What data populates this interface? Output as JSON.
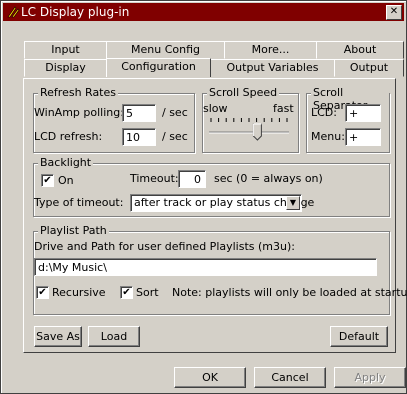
{
  "window": {
    "title": "LC Display plug-in",
    "close_glyph": "✕"
  },
  "tabs_row1": [
    "Input",
    "Menu Config",
    "More...",
    "About"
  ],
  "tabs_row2": [
    "Display",
    "Configuration",
    "Output Variables",
    "Output"
  ],
  "refresh": {
    "label": "Refresh Rates",
    "winamp_label": "WinAmp polling:",
    "winamp_value": "5",
    "winamp_unit": "/ sec",
    "lcd_label": "LCD refresh:",
    "lcd_value": "10",
    "lcd_unit": "/ sec"
  },
  "scroll_speed": {
    "label": "Scroll Speed",
    "slow": "slow",
    "fast": "fast",
    "level": 0.6
  },
  "scroll_sep": {
    "label": "Scroll Separator",
    "lcd_label": "LCD:",
    "lcd_value": "+",
    "menu_label": "Menu:",
    "menu_value": "+"
  },
  "backlight": {
    "label": "Backlight",
    "on_label": "On",
    "on_checked": "✔",
    "timeout_label": "Timeout:",
    "timeout_value": "0",
    "timeout_unit": "sec (0 = always on)",
    "type_label": "Type of timeout:",
    "type_value": "after track or play status change"
  },
  "playlist": {
    "label": "Playlist Path",
    "desc": "Drive and Path for user defined Playlists (m3u):",
    "path_value": "d:\\My Music\\",
    "recursive_label": "Recursive",
    "recursive_checked": "✔",
    "sort_label": "Sort",
    "sort_checked": "✔",
    "note": "Note: playlists will only be loaded at startup"
  },
  "buttons": {
    "save_as": "Save As",
    "load": "Load",
    "default": "Default",
    "ok": "OK",
    "cancel": "Cancel",
    "apply": "Apply"
  },
  "colors": {
    "titlebar": "#800000",
    "face": "#d4d0c8"
  }
}
